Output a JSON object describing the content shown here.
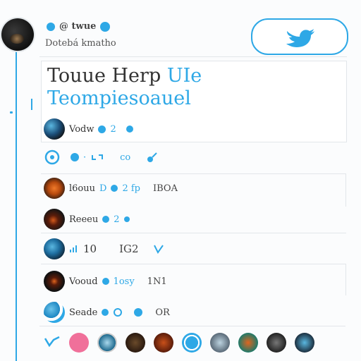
{
  "profile": {
    "handle": "@ twue",
    "subline": "Dotebá kmatho"
  },
  "headline": {
    "line1_dark": "Touue Herp",
    "line1_blue": "UIe",
    "line2": "Teompiesoauel"
  },
  "rows": [
    {
      "name": "Vodw",
      "meta": "2",
      "extra": ""
    },
    {
      "name": "·",
      "meta": "co",
      "extra": ""
    },
    {
      "name": "l6ouu",
      "meta": "D",
      "extra": "IBOA",
      "meta2": "2 fp"
    },
    {
      "name": "Reeeu",
      "meta": "2",
      "extra": ""
    },
    {
      "name": "10",
      "meta": "IG2",
      "extra": ""
    },
    {
      "name": "Vooud",
      "meta": "1osy",
      "extra": "1N1"
    },
    {
      "name": "Seade",
      "meta": "",
      "extra": "OR"
    }
  ],
  "colors": {
    "accent": "#2ea8e6",
    "text": "#333333",
    "border": "#e2e6ea"
  },
  "icons": [
    "twitter-bird-icon",
    "retweet-icon",
    "heart-icon"
  ]
}
